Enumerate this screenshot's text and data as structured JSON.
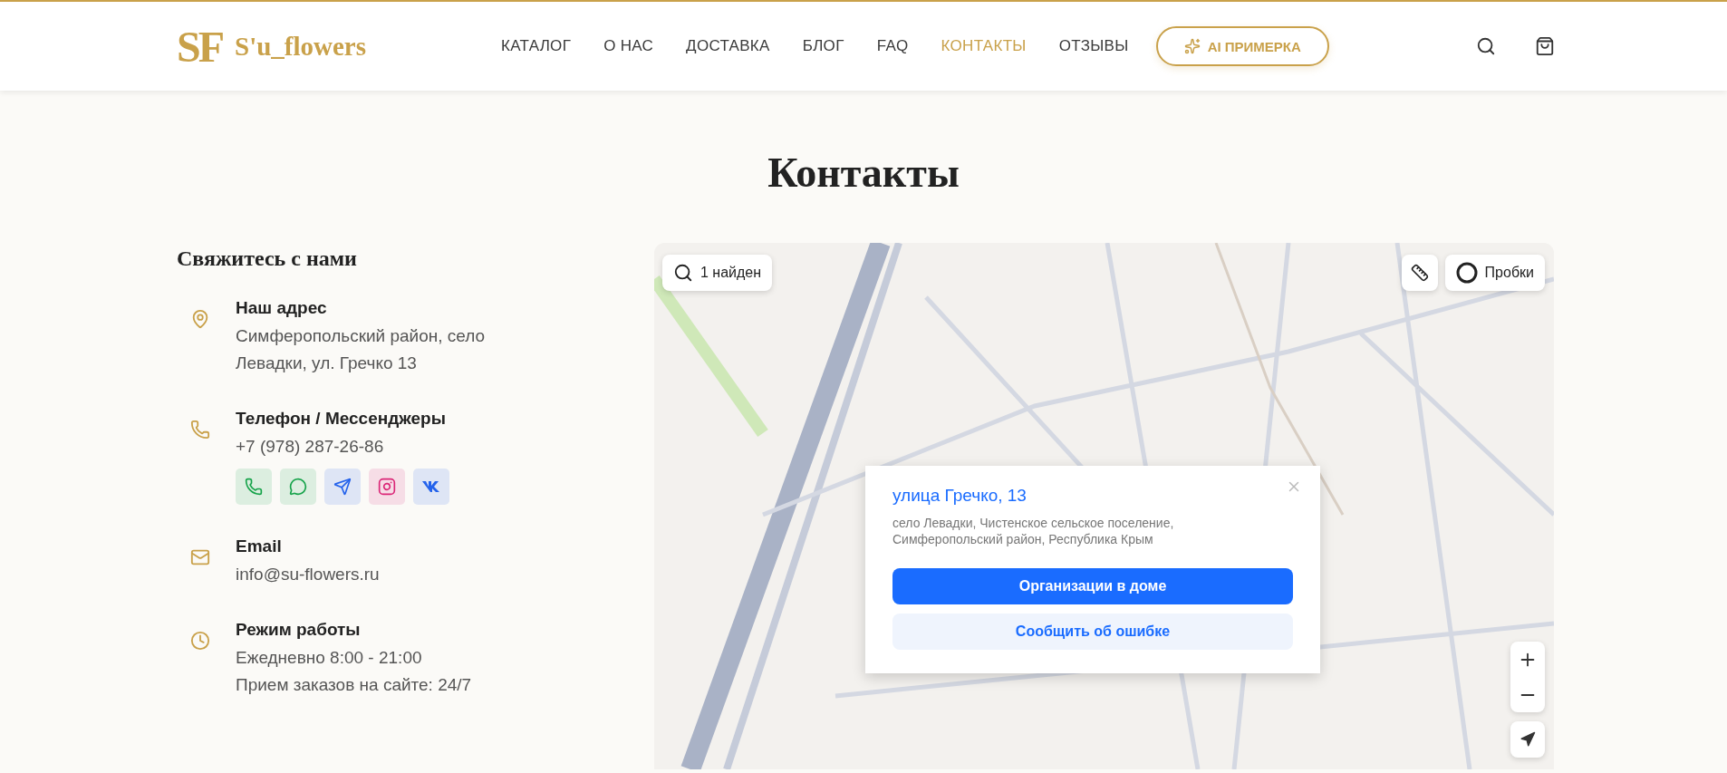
{
  "header": {
    "logo_mark": "SF",
    "brand": "S'u_flowers",
    "nav": [
      {
        "label": "КАТАЛОГ",
        "selected": false
      },
      {
        "label": "О НАС",
        "selected": false
      },
      {
        "label": "ДОСТАВКА",
        "selected": false
      },
      {
        "label": "БЛОГ",
        "selected": false
      },
      {
        "label": "FAQ",
        "selected": false
      },
      {
        "label": "КОНТАКТЫ",
        "selected": true
      },
      {
        "label": "ОТЗЫВЫ",
        "selected": false
      }
    ],
    "ai_button": "AI ПРИМЕРКА"
  },
  "title": "Контакты",
  "contacts": {
    "heading": "Свяжитесь с нами",
    "items": [
      {
        "kind": "address",
        "label": "Наш адрес",
        "lines": [
          "Симферопольский район, село",
          "Левадки, ул. Гречко 13"
        ]
      },
      {
        "kind": "phone",
        "label": "Телефон / Мессенджеры",
        "lines": [
          "+7 (978) 287-26-86"
        ],
        "socials": [
          {
            "kind": "call",
            "color": "#16a34a"
          },
          {
            "kind": "chat",
            "color": "#16a34a"
          },
          {
            "kind": "telegram",
            "color": "#2563eb"
          },
          {
            "kind": "instagram",
            "color": "#db2777"
          },
          {
            "kind": "vk",
            "color": "#2563eb"
          }
        ]
      },
      {
        "kind": "email",
        "label": "Email",
        "lines": [
          "info@su-flowers.ru"
        ]
      },
      {
        "kind": "hours",
        "label": "Режим работы",
        "lines": [
          "Ежедневно 8:00 - 21:00",
          "Прием заказов на сайте: 24/7"
        ]
      }
    ]
  },
  "map": {
    "search_result": "1 найден",
    "traffic": "Пробки",
    "popup": {
      "title": "улица Гречко, 13",
      "address": "село Левадки, Чистенское сельское поселение, Симферопольский район, Республика Крым",
      "primary_button": "Организации в доме",
      "secondary_button": "Сообщить об ошибке"
    }
  }
}
